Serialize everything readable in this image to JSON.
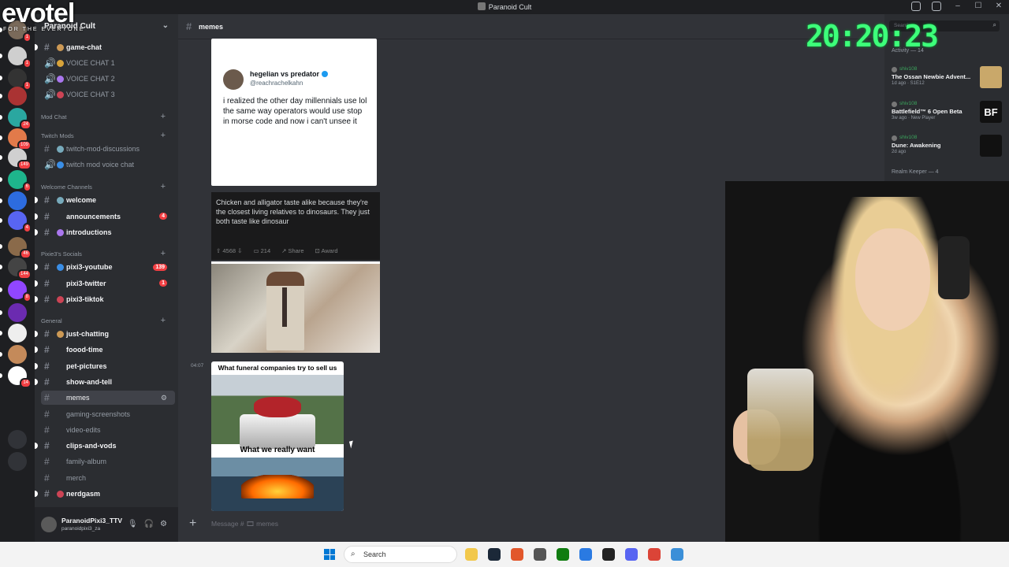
{
  "window": {
    "title": "Paranoid Cult"
  },
  "overlay": {
    "logo_big": "evotel",
    "logo_small": "FOR THE EVERYONE",
    "clock": "20:20:23"
  },
  "servers": [
    {
      "color": "#7a6a5a",
      "badge": "1"
    },
    {
      "color": "#cfcfcf",
      "badge": "1"
    },
    {
      "color": "#333333",
      "badge": "1"
    },
    {
      "color": "#a33",
      "badge": ""
    },
    {
      "color": "#2aa7a0",
      "badge": "24"
    },
    {
      "color": "#e27a4a",
      "badge": "109"
    },
    {
      "color": "#d0d0d0",
      "badge": "149"
    },
    {
      "color": "#1eb58c",
      "badge": "6"
    },
    {
      "color": "#2d6cdf",
      "badge": ""
    },
    {
      "color": "#5865f2",
      "badge": "4"
    },
    {
      "color": "#8a6a4a",
      "badge": "46"
    },
    {
      "color": "#444",
      "badge": "144"
    },
    {
      "color": "#9146ff",
      "badge": "8"
    },
    {
      "color": "#6b2bb0",
      "badge": ""
    },
    {
      "color": "#eeeeee",
      "badge": ""
    },
    {
      "color": "#c48a5a",
      "badge": ""
    },
    {
      "color": "#fff",
      "badge": "14"
    }
  ],
  "channel_list": {
    "server_name": "Paranoid Cult",
    "top": [
      {
        "name": "game-chat",
        "unread": true
      },
      {
        "name": "VOICE CHAT 1",
        "unread": false
      },
      {
        "name": "VOICE CHAT 2",
        "unread": false
      },
      {
        "name": "VOICE CHAT 3",
        "unread": false
      }
    ],
    "categories": [
      {
        "label": "Mod Chat"
      },
      {
        "label": "Twitch Mods"
      },
      {
        "label": "Welcome Channels"
      },
      {
        "label": "Pixie3's Socials"
      },
      {
        "label": "General"
      }
    ],
    "twitch_mods": [
      "twitch-mod-discussions",
      "twitch mod voice chat"
    ],
    "welcome": [
      {
        "name": "welcome",
        "badge": ""
      },
      {
        "name": "announcements",
        "badge": "4"
      },
      {
        "name": "introductions",
        "badge": ""
      }
    ],
    "socials": [
      {
        "name": "pixi3-youtube",
        "badge": "139"
      },
      {
        "name": "pixi3-twitter",
        "badge": "1"
      },
      {
        "name": "pixi3-tiktok",
        "badge": ""
      }
    ],
    "general": [
      {
        "name": "just-chatting",
        "unread": true
      },
      {
        "name": "foood-time",
        "unread": true
      },
      {
        "name": "pet-pictures",
        "unread": true
      },
      {
        "name": "show-and-tell",
        "unread": true
      },
      {
        "name": "memes",
        "unread": false,
        "active": true
      },
      {
        "name": "gaming-screenshots",
        "unread": false
      },
      {
        "name": "video-edits",
        "unread": false
      },
      {
        "name": "clips-and-vods",
        "unread": true
      },
      {
        "name": "family-album",
        "unread": false
      },
      {
        "name": "merch",
        "unread": false
      },
      {
        "name": "nerdgasm",
        "unread": true
      }
    ]
  },
  "user_panel": {
    "name": "ParanoidPixi3_TTV",
    "status": "paranoidpixi3_za"
  },
  "header": {
    "channel": "memes"
  },
  "messages": {
    "tweet": {
      "name": "hegelian vs predator",
      "handle": "@reachrachelkahn",
      "text": "i realized the other day millennials use lol the same way operators would use stop in morse code and now i can't unsee it"
    },
    "reddit": {
      "text": "Chicken and alligator taste alike because they're the closest living relatives to dinosaurs. They just both taste like dinosaur",
      "votes": "4568",
      "comments": "214",
      "share": "Share",
      "award": "Award"
    },
    "timestamp": "04:07",
    "meme": {
      "caption1": "What funeral companies try to sell us",
      "caption2": "What we really want"
    }
  },
  "composer": {
    "placeholder": "Message # 🎞 memes"
  },
  "right_panel": {
    "search_placeholder": "Search",
    "activity_label": "Activity — 14",
    "activities": [
      {
        "user": "shiv108",
        "game": "The Ossan Newbie Advent...",
        "detail": "1d ago · S1E12",
        "thumb": "",
        "color": "#c9a86a"
      },
      {
        "user": "shiv108",
        "game": "Battlefield™ 6 Open Beta",
        "detail": "3w ago · New Player",
        "thumb": "BF",
        "color": "#111111"
      },
      {
        "user": "shiv108",
        "game": "Dune: Awakening",
        "detail": "2d ago",
        "thumb": "",
        "color": "#111111"
      }
    ],
    "realm_label": "Realm Keeper — 4"
  },
  "taskbar": {
    "search": "Search"
  }
}
